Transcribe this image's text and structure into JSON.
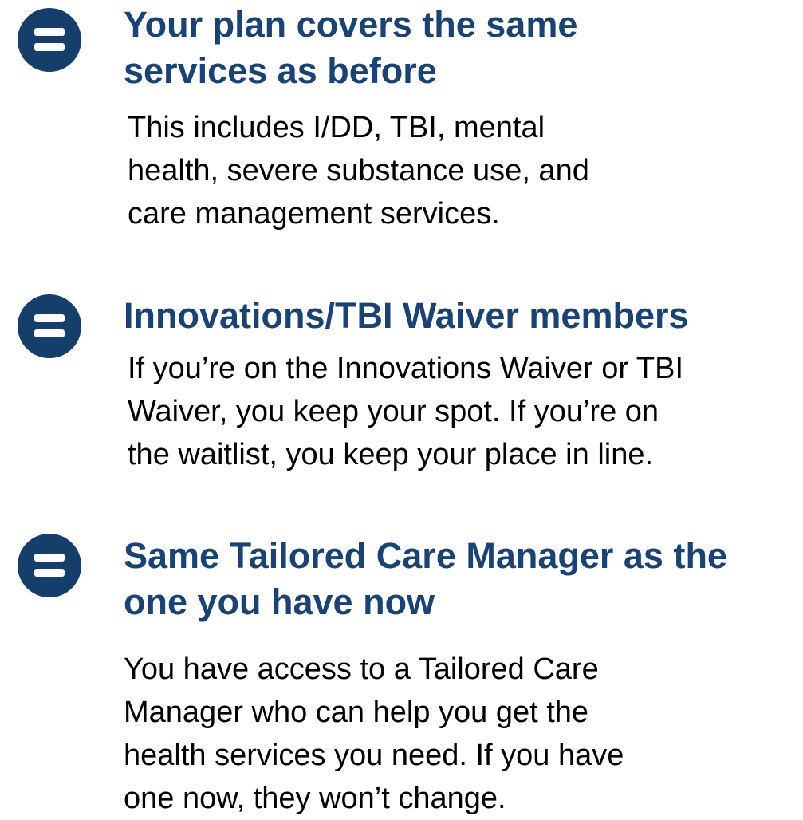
{
  "colors": {
    "heading": "#1a4374",
    "icon_background": "#153e6a",
    "icon_symbol": "#ffffff",
    "body_text": "#000000",
    "page_background": "#ffffff"
  },
  "items": [
    {
      "icon": "equals-icon",
      "title_lines": [
        "Your plan covers the same",
        "services as before"
      ],
      "body_lines": [
        "This includes I/DD, TBI, mental",
        "health, severe substance use, and",
        "care management services."
      ]
    },
    {
      "icon": "equals-icon",
      "title_lines": [
        "Innovations/TBI Waiver members"
      ],
      "body_lines": [
        "If you’re on the Innovations Waiver or TBI",
        "Waiver, you keep your spot. If you’re on",
        "the waitlist, you keep your place in line."
      ]
    },
    {
      "icon": "equals-icon",
      "title_lines": [
        "Same Tailored Care Manager as the",
        "one you have now"
      ],
      "body_lines": [
        "You have access to a Tailored Care",
        "Manager who can help you get the",
        "health services you need. If you have",
        "one now, they won’t change."
      ]
    }
  ]
}
